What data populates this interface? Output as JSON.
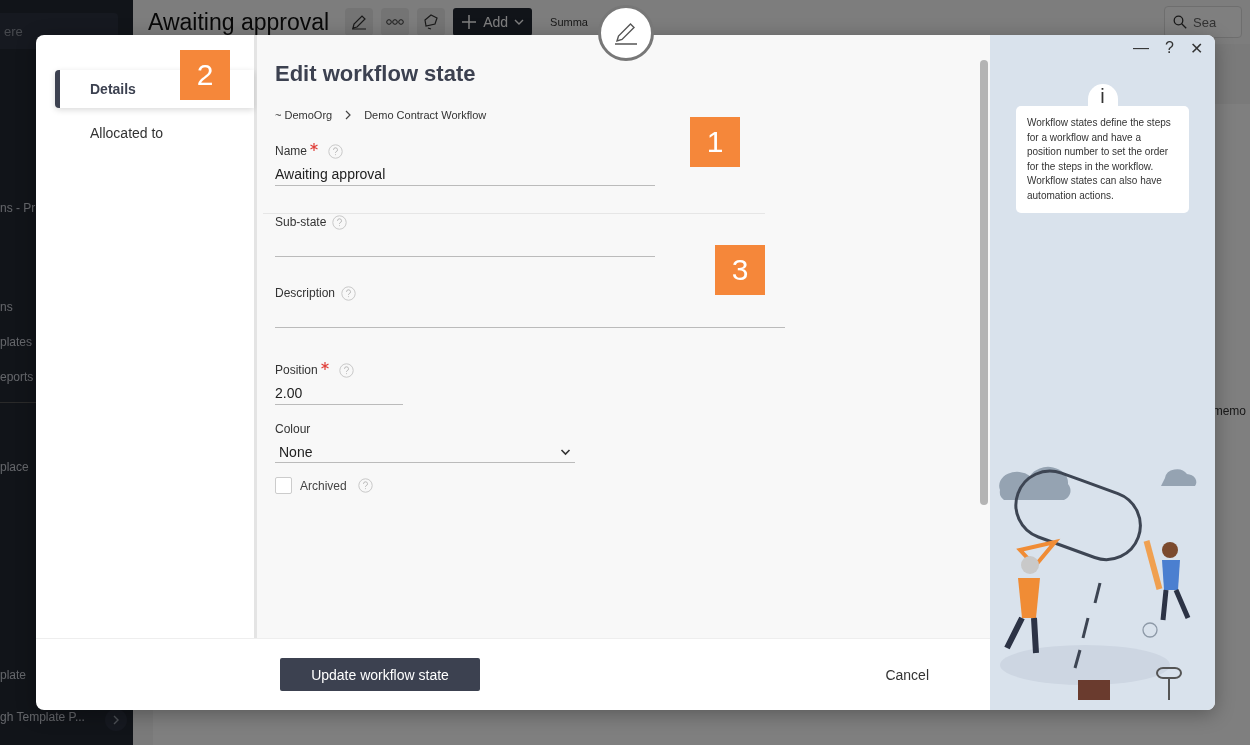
{
  "background": {
    "page_title": "Awaiting approval",
    "add_button": "Add",
    "summary_tab": "Summa",
    "search": {
      "placeholder": "Sea"
    },
    "sidebar_search": {
      "placeholder": "ere"
    },
    "sidebar_items": [
      {
        "label": "ns - Pr"
      },
      {
        "label": "ns"
      },
      {
        "label": "plates"
      },
      {
        "label": "eports"
      },
      {
        "label": "place"
      },
      {
        "label": "plate"
      },
      {
        "label": "gh Template P..."
      }
    ],
    "side_note": "memo"
  },
  "dialog": {
    "title": "Edit workflow state",
    "tabs": [
      {
        "label": "Details",
        "selected": true
      },
      {
        "label": "Allocated to",
        "selected": false
      }
    ],
    "breadcrumb": [
      "~ DemoOrg",
      "Demo Contract Workflow"
    ],
    "fields": [
      {
        "kind": "text",
        "label": "Name",
        "required": true,
        "help": true,
        "value": "Awaiting approval"
      },
      {
        "kind": "text",
        "label": "Sub-state",
        "required": false,
        "help": true
      },
      {
        "kind": "wide",
        "label": "Description",
        "required": false,
        "help": true
      },
      {
        "kind": "number",
        "label": "Position",
        "required": true,
        "help": true,
        "value": "2.00"
      },
      {
        "kind": "select",
        "label": "Colour",
        "required": false,
        "help": false,
        "value": "None"
      },
      {
        "kind": "checkbox",
        "label": "Archived",
        "help": true,
        "checked": false
      }
    ],
    "info_icon": "i",
    "info_text": "Workflow states define the steps for a workflow and have a position number to set the order for the steps in the workflow. Workflow states can also have automation actions.",
    "window_controls": {
      "minimize": "—",
      "help": "?",
      "close": "✕"
    },
    "buttons": [
      {
        "kind": "primary",
        "label": "Update workflow state"
      },
      {
        "kind": "link",
        "label": "Cancel"
      }
    ],
    "markers": [
      {
        "label": "1"
      },
      {
        "label": "2"
      },
      {
        "label": "3"
      }
    ]
  }
}
